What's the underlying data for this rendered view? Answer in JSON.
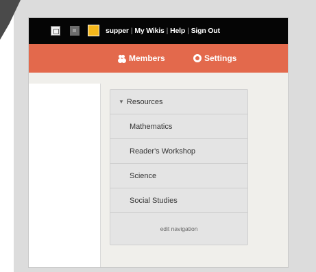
{
  "topbar": {
    "username": "supper",
    "links": [
      "My Wikis",
      "Help",
      "Sign Out"
    ]
  },
  "subnav": {
    "members_label": "Members",
    "settings_label": "Settings"
  },
  "navigation": {
    "heading": "Resources",
    "items": [
      "Mathematics",
      "Reader's Workshop",
      "Science",
      "Social Studies"
    ],
    "edit_label": "edit navigation"
  },
  "colors": {
    "topbar": "#050505",
    "subbar": "#e3694c",
    "panel": "#e4e4e4"
  },
  "icons": {
    "members": "people-icon",
    "settings": "gear-icon",
    "heading": "triangle-down-icon"
  }
}
